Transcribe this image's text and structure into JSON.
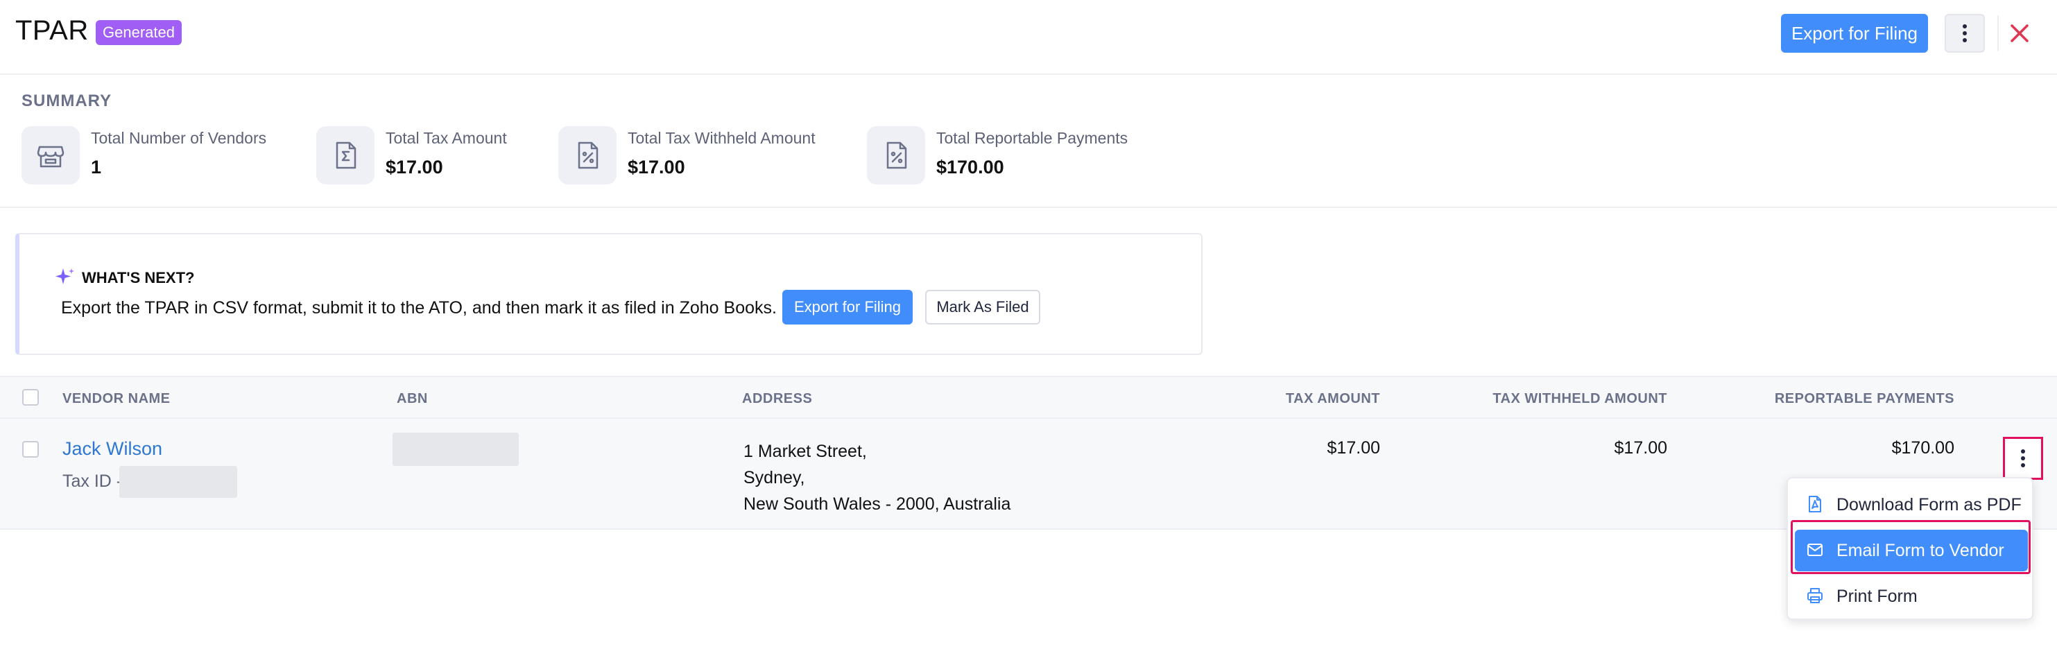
{
  "header": {
    "title": "TPAR",
    "badge": "Generated",
    "export_label": "Export for Filing"
  },
  "summary": {
    "title": "SUMMARY",
    "items": [
      {
        "label": "Total Number of Vendors",
        "value": "1",
        "icon": "store-icon"
      },
      {
        "label": "Total Tax Amount",
        "value": "$17.00",
        "icon": "sigma-document-icon"
      },
      {
        "label": "Total Tax Withheld Amount",
        "value": "$17.00",
        "icon": "percent-document-icon"
      },
      {
        "label": "Total Reportable Payments",
        "value": "$170.00",
        "icon": "percent-document-icon"
      }
    ]
  },
  "next": {
    "title": "WHAT'S NEXT?",
    "text": "Export the TPAR in CSV format, submit it to the ATO, and then mark it as filed in Zoho Books.",
    "export_label": "Export for Filing",
    "mark_label": "Mark As Filed"
  },
  "table": {
    "columns": [
      "VENDOR NAME",
      "ABN",
      "ADDRESS",
      "TAX AMOUNT",
      "TAX WITHHELD AMOUNT",
      "REPORTABLE PAYMENTS"
    ],
    "rows": [
      {
        "vendor_name": "Jack Wilson",
        "tax_id_label": "Tax ID -",
        "address": [
          "1 Market Street,",
          "Sydney,",
          "New South Wales - 2000, Australia"
        ],
        "tax_amount": "$17.00",
        "tax_withheld": "$17.00",
        "reportable": "$170.00"
      }
    ]
  },
  "menu": {
    "items": [
      {
        "label": "Download Form as PDF",
        "icon": "pdf-file-icon"
      },
      {
        "label": "Email Form to Vendor",
        "icon": "envelope-icon",
        "active": true
      },
      {
        "label": "Print Form",
        "icon": "printer-icon"
      }
    ]
  },
  "colors": {
    "primary": "#408dfb",
    "badge": "#a15ef5",
    "link": "#2e78d3",
    "close": "#e0364f",
    "highlight": "#e0115f"
  }
}
